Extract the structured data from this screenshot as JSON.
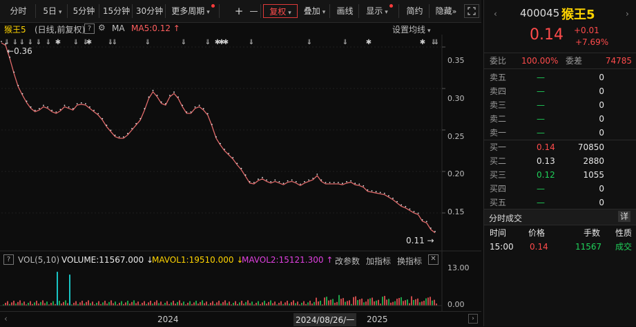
{
  "toolbar": {
    "tabs": [
      "分时",
      "5日",
      "5分钟",
      "15分钟",
      "30分钟",
      "更多周期"
    ],
    "tools": [
      "+",
      "—",
      "复权",
      "叠加",
      "画线",
      "显示",
      "简约",
      "隐藏"
    ],
    "more_arrows": "»"
  },
  "info": {
    "name": "猴王5",
    "mode": "(日线,前复权)",
    "ma_label": "MA",
    "ma5": "MA5:0.12",
    "settings": "设置均线"
  },
  "chart_data": {
    "type": "line",
    "title": "",
    "y_ticks": [
      "0.35",
      "0.30",
      "0.25",
      "0.20",
      "0.15"
    ],
    "ylim": [
      0.115,
      0.365
    ],
    "max_label": "0.36",
    "min_label": "0.11",
    "x_labels": [
      "2024",
      "2024/08/26/一",
      "2025"
    ],
    "series": [
      {
        "values": [
          0.355,
          0.352,
          0.336,
          0.318,
          0.302,
          0.292,
          0.283,
          0.276,
          0.272,
          0.274,
          0.278,
          0.276,
          0.272,
          0.27,
          0.273,
          0.278,
          0.276,
          0.274,
          0.28,
          0.281,
          0.28,
          0.276,
          0.272,
          0.268,
          0.262,
          0.254,
          0.248,
          0.242,
          0.24,
          0.24,
          0.244,
          0.25,
          0.256,
          0.262,
          0.274,
          0.288,
          0.296,
          0.29,
          0.282,
          0.28,
          0.29,
          0.294,
          0.288,
          0.278,
          0.27,
          0.27,
          0.276,
          0.278,
          0.274,
          0.268,
          0.255,
          0.24,
          0.232,
          0.225,
          0.22,
          0.215,
          0.208,
          0.202,
          0.194,
          0.186,
          0.185,
          0.189,
          0.191,
          0.188,
          0.186,
          0.188,
          0.186,
          0.184,
          0.187,
          0.188,
          0.186,
          0.183,
          0.186,
          0.188,
          0.19,
          0.195,
          0.188,
          0.185,
          0.185,
          0.185,
          0.185,
          0.184,
          0.186,
          0.187,
          0.184,
          0.183,
          0.181,
          0.176,
          0.175,
          0.174,
          0.173,
          0.172,
          0.169,
          0.166,
          0.162,
          0.158,
          0.156,
          0.153,
          0.15,
          0.148,
          0.14,
          0.138,
          0.13,
          0.126
        ],
        "color": "#e06a6a"
      }
    ],
    "volume": {
      "label": "VOL(5,10)",
      "volume": "VOLUME:11567.000",
      "mavol1": "MAVOL1:19510.000",
      "mavol2": "MAVOL2:15121.300",
      "y_ticks": [
        "13.00",
        "0.00"
      ],
      "spikes": [
        12.0,
        11.0
      ],
      "ylim": [
        0,
        14
      ]
    }
  },
  "vol_tools": [
    "改参数",
    "加指标",
    "换指标"
  ],
  "quote": {
    "code": "400045",
    "name": "猴王5",
    "price": "0.14",
    "change": "+0.01",
    "change_pct": "+7.69%",
    "webi_label": "委比",
    "webi_value": "100.00%",
    "weicha_label": "委差",
    "weicha_value": "74785",
    "asks": [
      {
        "label": "卖五",
        "price": "—",
        "vol": "0"
      },
      {
        "label": "卖四",
        "price": "—",
        "vol": "0"
      },
      {
        "label": "卖三",
        "price": "—",
        "vol": "0"
      },
      {
        "label": "卖二",
        "price": "—",
        "vol": "0"
      },
      {
        "label": "卖一",
        "price": "—",
        "vol": "0"
      }
    ],
    "bids": [
      {
        "label": "买一",
        "price": "0.14",
        "vol": "70850"
      },
      {
        "label": "买二",
        "price": "0.13",
        "vol": "2880"
      },
      {
        "label": "买三",
        "price": "0.12",
        "vol": "1055"
      },
      {
        "label": "买四",
        "price": "—",
        "vol": "0"
      },
      {
        "label": "买五",
        "price": "—",
        "vol": "0"
      }
    ],
    "ticks_title": "分时成交",
    "ticks_detail": "详",
    "ticks_headers": [
      "时间",
      "价格",
      "手数",
      "性质"
    ],
    "ticks": [
      {
        "time": "15:00",
        "price": "0.14",
        "vol": "11567",
        "type": "成交"
      }
    ]
  },
  "colors": {
    "up": "#ff4b4b",
    "down": "#1fd15a",
    "line": "#e06a6a"
  }
}
